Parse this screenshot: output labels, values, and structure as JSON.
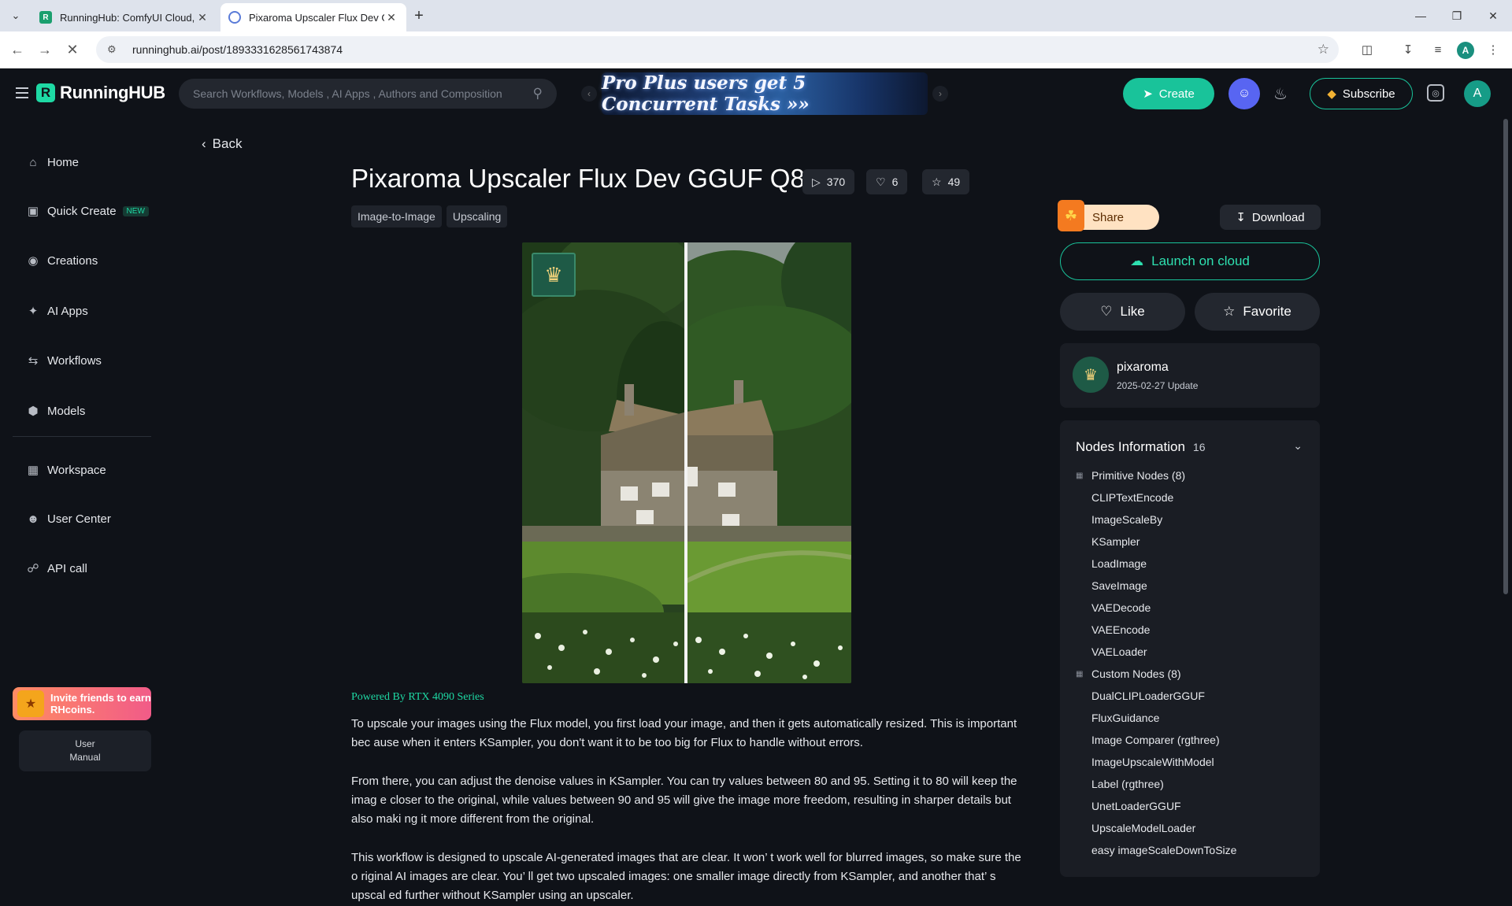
{
  "browser": {
    "tabs": [
      {
        "title": "RunningHub: ComfyUI Cloud, C",
        "favicon": "runninghub-favicon"
      },
      {
        "title": "Pixaroma Upscaler Flux Dev GG",
        "favicon": "pixaroma-favicon"
      }
    ],
    "url": "runninghub.ai/post/1893331628561743874",
    "profile_initial": "A"
  },
  "header": {
    "logo_text": "RunningHUB",
    "search_placeholder": "Search Workflows, Models , AI Apps , Authors and Composition",
    "banner_text": "Pro Plus users get 5 Concurrent Tasks »»",
    "create_label": "Create",
    "subscribe_label": "Subscribe",
    "avatar_initial": "A",
    "accent": "#19c39a"
  },
  "sidebar": {
    "items": [
      {
        "label": "Home",
        "icon": "home-icon"
      },
      {
        "label": "Quick Create",
        "icon": "quick-create-icon",
        "badge": "NEW"
      },
      {
        "label": "Creations",
        "icon": "creations-icon"
      },
      {
        "label": "AI Apps",
        "icon": "ai-apps-icon"
      },
      {
        "label": "Workflows",
        "icon": "workflows-icon"
      },
      {
        "label": "Models",
        "icon": "models-icon"
      },
      {
        "label": "Workspace",
        "icon": "workspace-icon"
      },
      {
        "label": "User Center",
        "icon": "user-icon"
      },
      {
        "label": "API call",
        "icon": "api-icon"
      }
    ],
    "invite_text": "Invite friends to earn RHcoins.",
    "manual_line1": "User",
    "manual_line2": "Manual"
  },
  "post": {
    "back_label": "Back",
    "title": "Pixaroma Upscaler Flux Dev GGUF Q8",
    "runs": "370",
    "likes": "6",
    "favorites": "49",
    "tags": [
      "Image-to-Image",
      "Upscaling"
    ],
    "powered_by": "Powered By RTX 4090 Series",
    "paragraphs": [
      "To upscale your images using the Flux model, you first load your image, and then it gets automatically resized. This is important bec ause when it enters KSampler, you don't want it to be too big for Flux to handle without errors.",
      "From there, you can adjust the denoise values in KSampler. You can try values between 80 and 95. Setting it to 80 will keep the imag e closer to the original, while values between 90 and 95 will give the image more freedom, resulting in sharper details but also maki ng it more different from the original.",
      "This workflow is designed to upscale AI-generated images that are clear. It won’ t work well for blurred images, so make sure the o riginal AI images are clear. You’ ll get two upscaled images: one smaller image directly from KSampler, and another that’ s upscal ed further without KSampler using an upscaler."
    ]
  },
  "actions": {
    "share_label": "Share",
    "download_label": "Download",
    "launch_label": "Launch on cloud",
    "like_label": "Like",
    "favorite_label": "Favorite"
  },
  "author": {
    "name": "pixaroma",
    "date": "2025-02-27 Update"
  },
  "nodes": {
    "title": "Nodes Information",
    "count": "16",
    "primary_group": "Primitive Nodes (8)",
    "primary": [
      "CLIPTextEncode",
      "ImageScaleBy",
      "KSampler",
      "LoadImage",
      "SaveImage",
      "VAEDecode",
      "VAEEncode",
      "VAELoader"
    ],
    "custom_group": "Custom Nodes (8)",
    "custom": [
      "DualCLIPLoaderGGUF",
      "FluxGuidance",
      "Image Comparer (rgthree)",
      "ImageUpscaleWithModel",
      "Label (rgthree)",
      "UnetLoaderGGUF",
      "UpscaleModelLoader",
      "easy imageScaleDownToSize"
    ]
  }
}
